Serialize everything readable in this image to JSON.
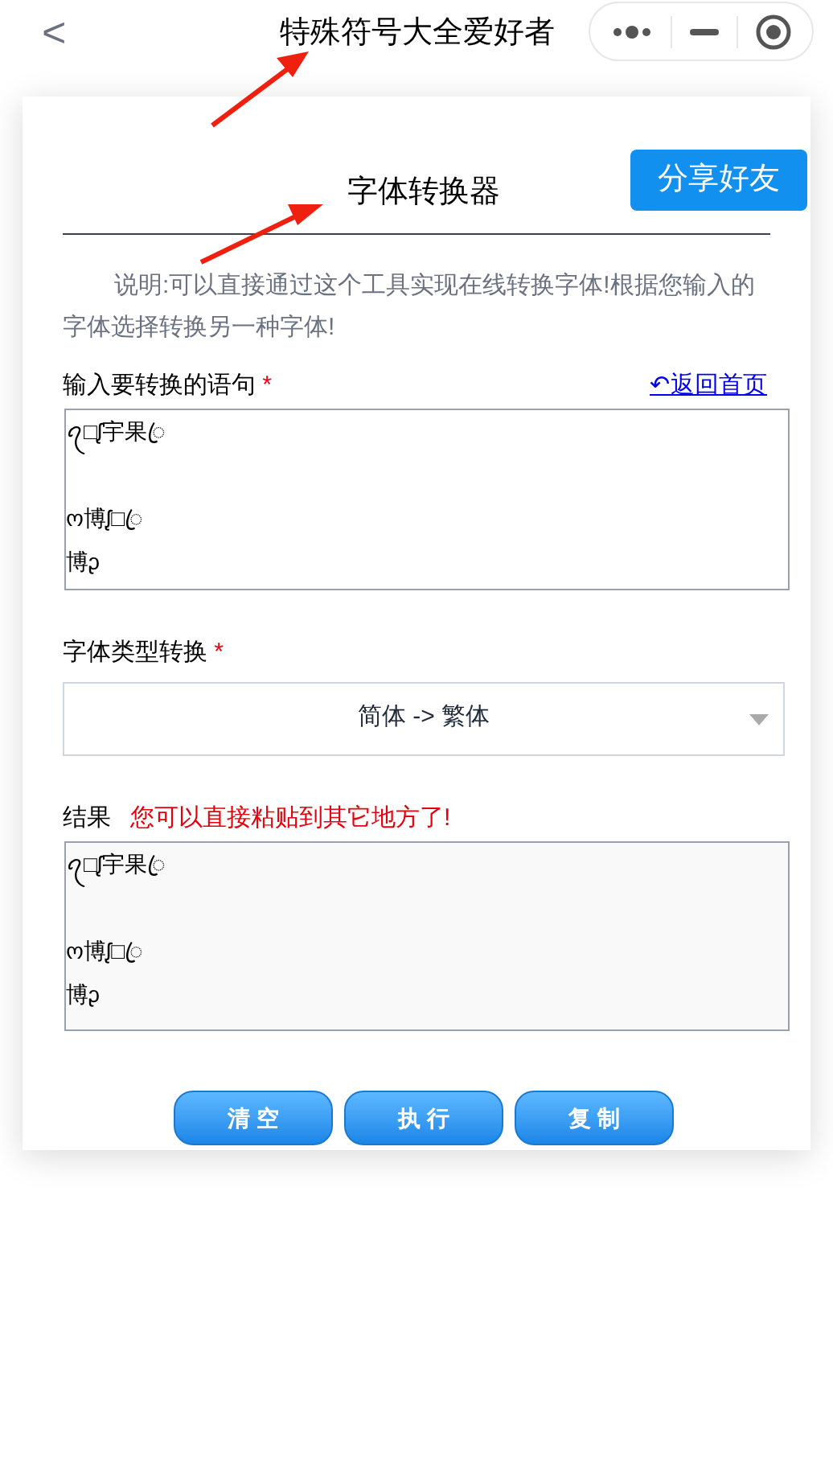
{
  "nav_bar": {
    "back": "<",
    "title": "特殊符号大全爱好者"
  },
  "card": {
    "share_button": "分享好友",
    "heading": "字体转换器",
    "description": "说明:可以直接通过这个工具实现在线转换字体!根据您输入的字体选择转换另一种字体!",
    "input": {
      "label": "输入要转换的语句",
      "required": "*",
      "link": "↶返回首页",
      "paragraphs": [
        [
          "ꪖ□ᶘ宇果ꦿ"
        ],
        [
          "ო博ᶘ□ꦿ",
          "博ᶗ"
        ]
      ]
    },
    "font_type": {
      "label": "字体类型转换",
      "required": "*",
      "value": "简体 -> 繁体"
    },
    "result": {
      "label": "结果",
      "note": "您可以直接粘贴到其它地方了!",
      "paragraphs": [
        [
          "ꪖ□ᶘ宇果ꦿ"
        ],
        [
          "ო博ᶘ□ꦿ",
          "博ᶗ"
        ]
      ]
    },
    "buttons": [
      "清 空",
      "执 行",
      "复 制"
    ]
  }
}
